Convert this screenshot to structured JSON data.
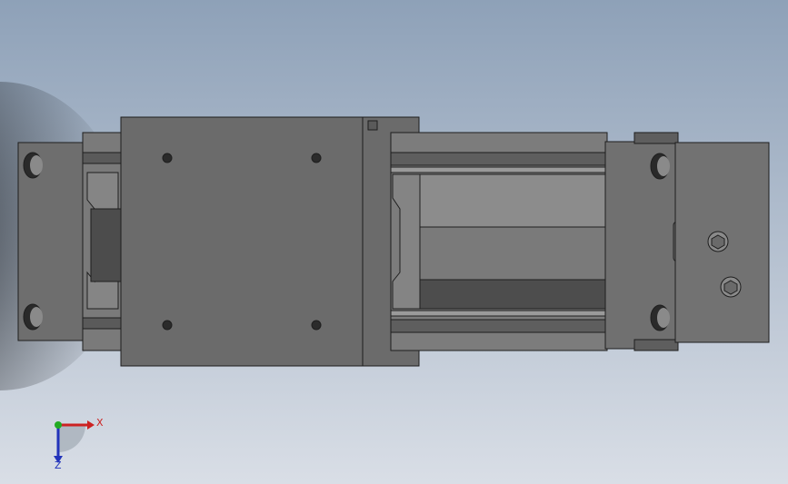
{
  "viewport": {
    "background_top": "#8ea1b8",
    "background_bottom": "#d7dde5",
    "shadow_color": "#1a1d22"
  },
  "model": {
    "part_color": "#6f6f6f",
    "part_dark": "#4a4a4a",
    "edge_color": "#1e1e1e",
    "rail_light": "#8a8a8a"
  },
  "triad": {
    "x_label": "X",
    "z_label": "Z",
    "x_color": "#cc2222",
    "y_color": "#22aa22",
    "z_color": "#2233bb"
  }
}
